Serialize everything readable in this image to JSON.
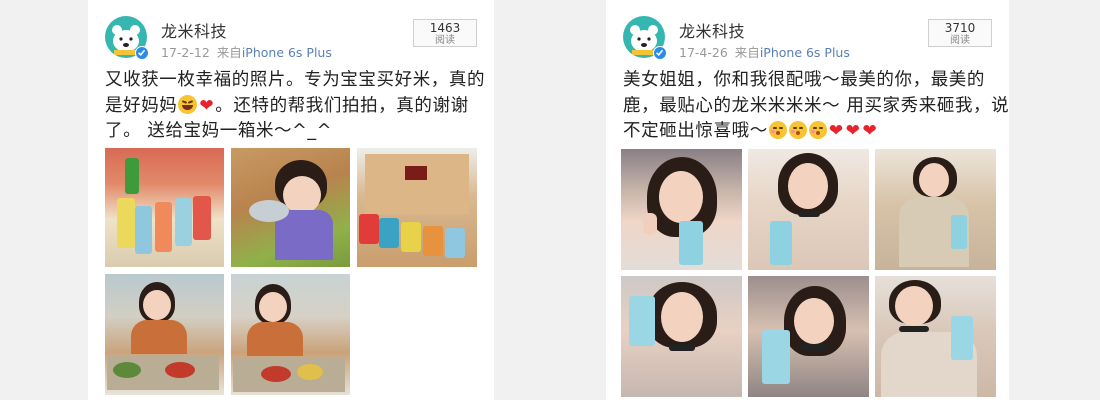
{
  "posts": [
    {
      "author": "龙米科技",
      "date": "17-2-12",
      "source_prefix": "来自",
      "source_link": "iPhone 6s Plus",
      "read_count": "1463",
      "read_label": "阅读",
      "text_lines": [
        {
          "a": "又收获一枚幸福的照片。专为宝宝买好米，真的"
        },
        {
          "a": "是好妈妈",
          "b": "。还特的帮我们拍拍，真的谢谢"
        },
        {
          "a": "了。 送给宝妈一箱米～^_^"
        }
      ],
      "photo_count": 5
    },
    {
      "author": "龙米科技",
      "date": "17-4-26",
      "source_prefix": "来自",
      "source_link": "iPhone 6s Plus",
      "read_count": "3710",
      "read_label": "阅读",
      "text_lines": [
        {
          "a": "美女姐姐，你和我很配哦～最美的你，最美的"
        },
        {
          "a": "鹿，最贴心的龙米米米米～ 用买家秀来砸我，说"
        },
        {
          "a": "不定砸出惊喜哦～"
        }
      ],
      "photo_count": 6
    }
  ],
  "icons": {
    "avatar": "polar-bear-avatar-icon",
    "verified": "verified-badge-icon",
    "emoji": [
      "laugh-cry-emoji-icon",
      "red-heart-emoji-icon",
      "blushing-kiss-emoji-icon"
    ]
  },
  "colors": {
    "avatar_bg": "#35b6b1",
    "verified_badge": "#2a8be8",
    "source_link": "#5a7fb6",
    "heart": "#e8232c"
  }
}
